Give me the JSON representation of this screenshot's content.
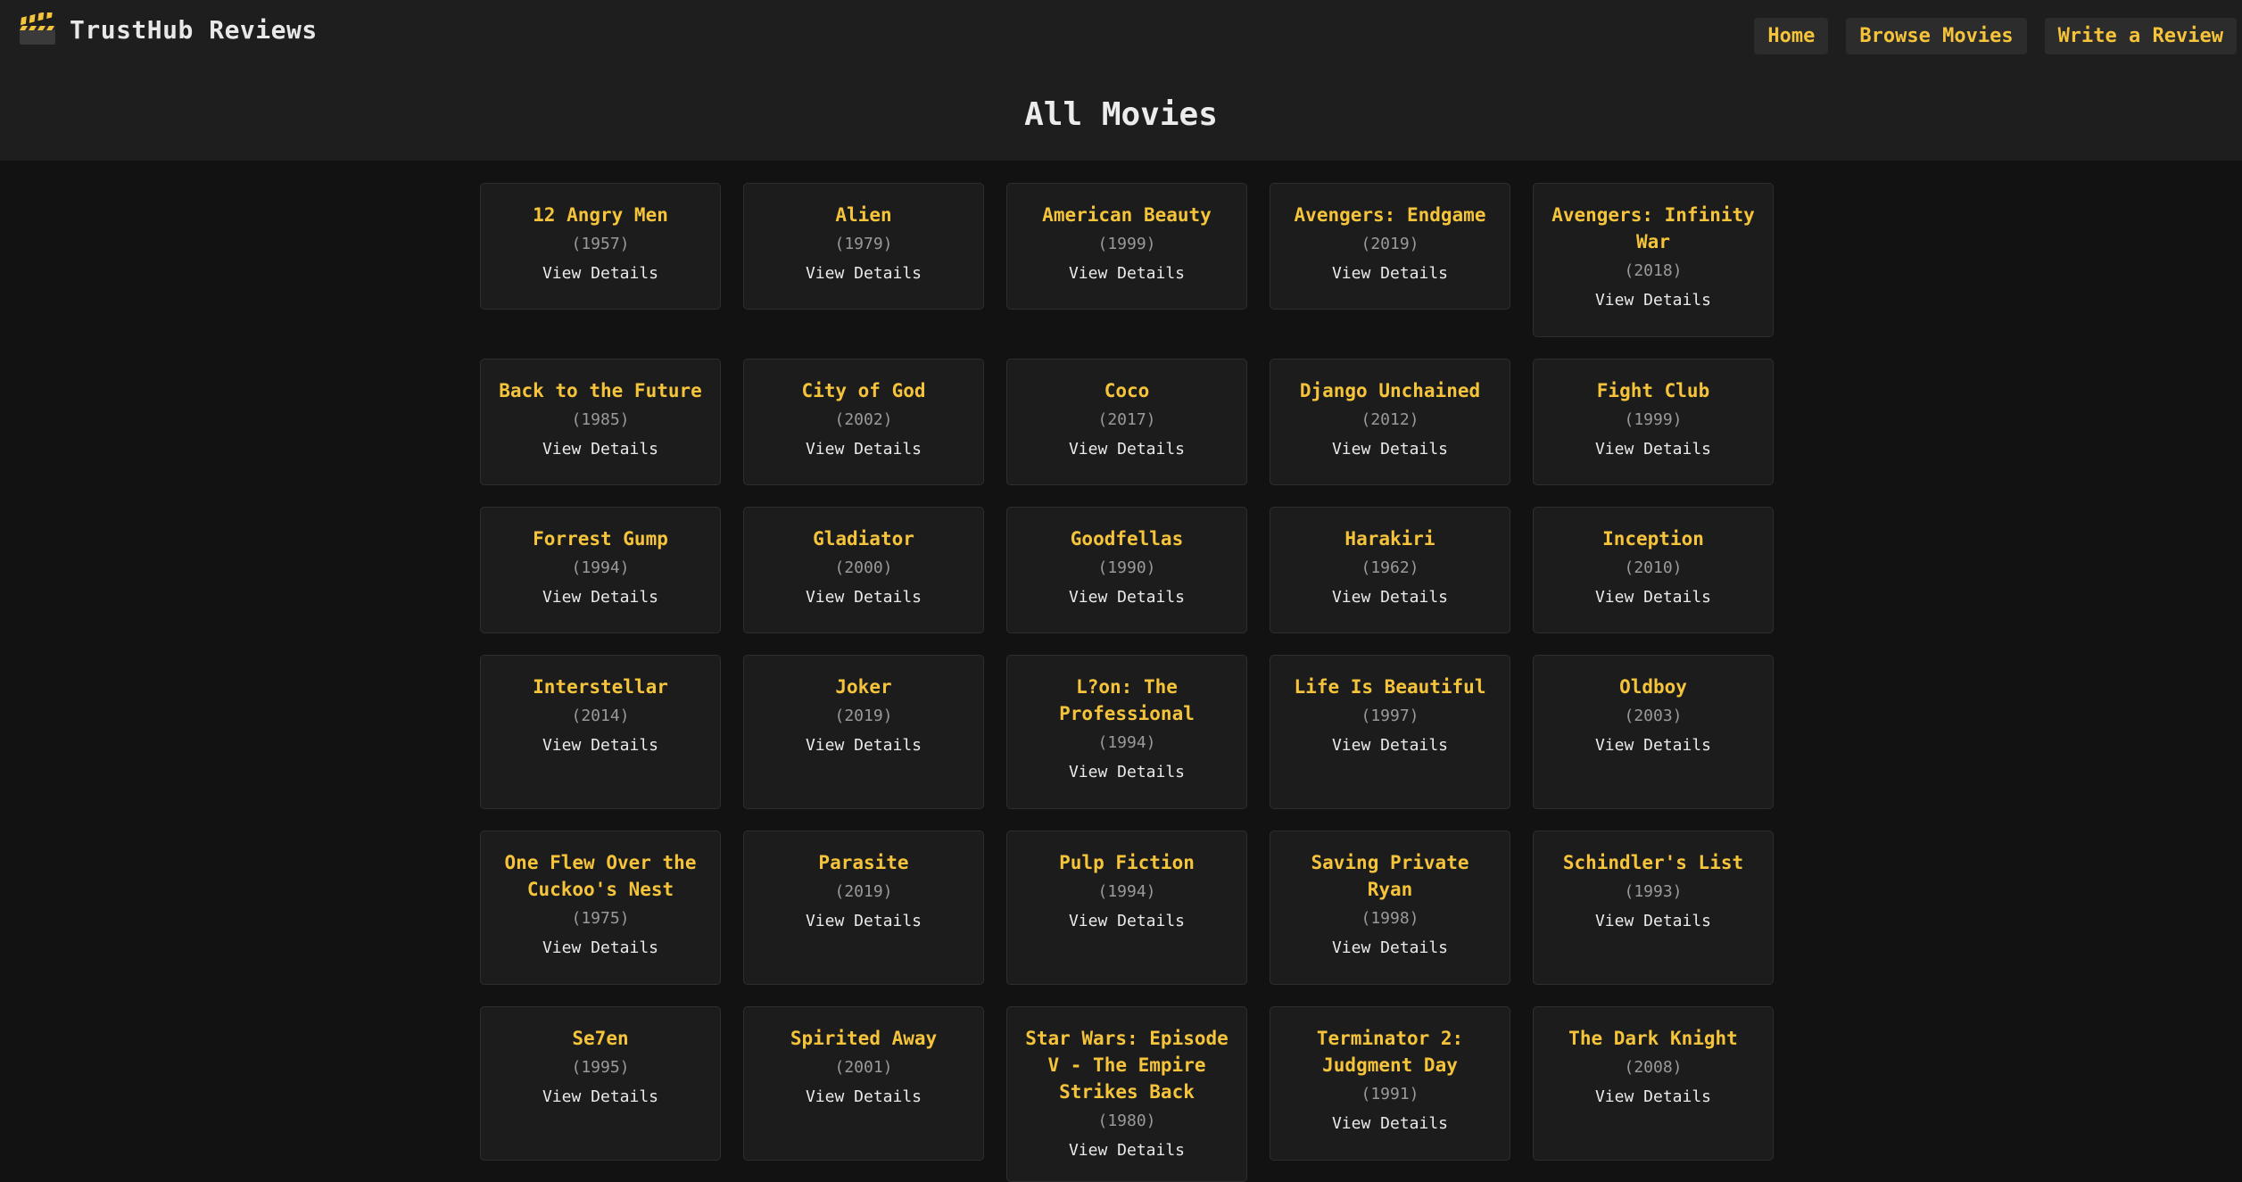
{
  "header": {
    "brand": "TrustHub Reviews",
    "brand_icon": "clapperboard-icon",
    "nav": [
      "Home",
      "Browse Movies",
      "Write a Review"
    ],
    "page_title": "All Movies"
  },
  "movies": [
    {
      "title": "12 Angry Men",
      "year": "(1957)"
    },
    {
      "title": "Alien",
      "year": "(1979)"
    },
    {
      "title": "American Beauty",
      "year": "(1999)"
    },
    {
      "title": "Avengers: Endgame",
      "year": "(2019)"
    },
    {
      "title": "Avengers: Infinity War",
      "year": "(2018)"
    },
    {
      "title": "Back to the Future",
      "year": "(1985)"
    },
    {
      "title": "City of God",
      "year": "(2002)"
    },
    {
      "title": "Coco",
      "year": "(2017)"
    },
    {
      "title": "Django Unchained",
      "year": "(2012)"
    },
    {
      "title": "Fight Club",
      "year": "(1999)"
    },
    {
      "title": "Forrest Gump",
      "year": "(1994)"
    },
    {
      "title": "Gladiator",
      "year": "(2000)"
    },
    {
      "title": "Goodfellas",
      "year": "(1990)"
    },
    {
      "title": "Harakiri",
      "year": "(1962)"
    },
    {
      "title": "Inception",
      "year": "(2010)"
    },
    {
      "title": "Interstellar",
      "year": "(2014)"
    },
    {
      "title": "Joker",
      "year": "(2019)"
    },
    {
      "title": "L?on: The Professional",
      "year": "(1994)"
    },
    {
      "title": "Life Is Beautiful",
      "year": "(1997)"
    },
    {
      "title": "Oldboy",
      "year": "(2003)"
    },
    {
      "title": "One Flew Over the Cuckoo's Nest",
      "year": "(1975)"
    },
    {
      "title": "Parasite",
      "year": "(2019)"
    },
    {
      "title": "Pulp Fiction",
      "year": "(1994)"
    },
    {
      "title": "Saving Private Ryan",
      "year": "(1998)"
    },
    {
      "title": "Schindler's List",
      "year": "(1993)"
    },
    {
      "title": "Se7en",
      "year": "(1995)"
    },
    {
      "title": "Spirited Away",
      "year": "(2001)"
    },
    {
      "title": "Star Wars: Episode V - The Empire Strikes Back",
      "year": "(1980)"
    },
    {
      "title": "Terminator 2: Judgment Day",
      "year": "(1991)"
    },
    {
      "title": "The Dark Knight",
      "year": "(2008)"
    }
  ],
  "card_link_label": "View Details",
  "colors": {
    "accent": "#f5c43b",
    "background": "#121212",
    "header": "#1e1e1e",
    "card": "#1c1c1c"
  }
}
